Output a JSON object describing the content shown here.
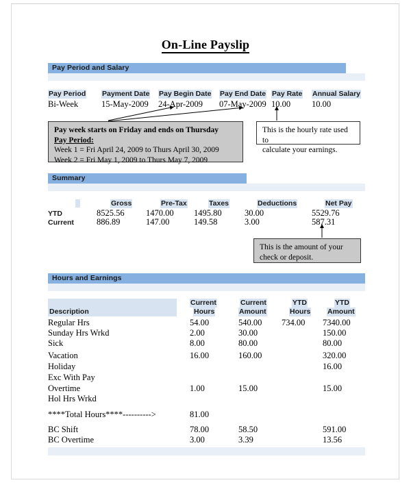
{
  "document": {
    "title": "On-Line Payslip"
  },
  "sections": {
    "pay_period": {
      "heading": "Pay Period and Salary"
    },
    "summary": {
      "heading": "Summary"
    },
    "hours_earnings": {
      "heading": "Hours and Earnings"
    }
  },
  "pay_period_table": {
    "headers": [
      "Pay Period",
      "Payment Date",
      "Pay Begin Date",
      "Pay End Date",
      "Pay Rate",
      "Annual Salary"
    ],
    "values": [
      "Bi-Week",
      "15-May-2009",
      "24-Apr-2009",
      "07-May-2009",
      "10.00",
      "10.00"
    ]
  },
  "callouts": {
    "pay_week": {
      "line1": "Pay week starts on Friday and ends on Thursday",
      "line2": "Pay Period:",
      "line3": "Week 1 = Fri April 24, 2009 to Thurs April 30, 2009",
      "line4": "Week 2 = Fri May 1, 2009 to Thurs May 7, 2009"
    },
    "hourly_rate": {
      "line1": "This is the hourly rate used to",
      "line2": "calculate your earnings."
    },
    "net_pay": {
      "line1": "This is the amount of your",
      "line2": "check or deposit."
    }
  },
  "summary_table": {
    "headers": [
      "",
      "Gross",
      "Pre-Tax",
      "Taxes",
      "Deductions",
      "Net Pay"
    ],
    "rows": [
      {
        "label": "YTD",
        "gross": "8525.56",
        "pre_tax": "1470.00",
        "taxes": "1495.80",
        "deductions": "30.00",
        "net_pay": "5529.76"
      },
      {
        "label": "Current",
        "gross": "886.89",
        "pre_tax": "147.00",
        "taxes": "149.58",
        "deductions": "3.00",
        "net_pay": "587.31"
      }
    ]
  },
  "earnings_table": {
    "headers": {
      "description": "Description",
      "current_hours_l1": "Current",
      "current_hours_l2": "Hours",
      "current_amount_l1": "Current",
      "current_amount_l2": "Amount",
      "ytd_hours_l1": "YTD",
      "ytd_hours_l2": "Hours",
      "ytd_amount_l1": "YTD",
      "ytd_amount_l2": "Amount"
    },
    "rows": [
      {
        "description": "Regular Hrs",
        "current_hours": "54.00",
        "current_amount": "540.00",
        "ytd_hours": "734.00",
        "ytd_amount": "7340.00"
      },
      {
        "description": "Sunday Hrs Wrkd",
        "current_hours": "2.00",
        "current_amount": "30.00",
        "ytd_hours": "",
        "ytd_amount": "150.00"
      },
      {
        "description": "Sick",
        "current_hours": "8.00",
        "current_amount": "80.00",
        "ytd_hours": "",
        "ytd_amount": "80.00"
      },
      {
        "description": "Vacation",
        "current_hours": "16.00",
        "current_amount": "160.00",
        "ytd_hours": "",
        "ytd_amount": "320.00"
      },
      {
        "description": "Holiday",
        "current_hours": "",
        "current_amount": "",
        "ytd_hours": "",
        "ytd_amount": "16.00"
      },
      {
        "description": "Exc With Pay",
        "current_hours": "",
        "current_amount": "",
        "ytd_hours": "",
        "ytd_amount": ""
      },
      {
        "description": "Overtime",
        "current_hours": "1.00",
        "current_amount": "15.00",
        "ytd_hours": "",
        "ytd_amount": "15.00"
      },
      {
        "description": "Hol Hrs Wrkd",
        "current_hours": "",
        "current_amount": "",
        "ytd_hours": "",
        "ytd_amount": ""
      }
    ],
    "total_row": {
      "description": "****Total Hours****---------->",
      "current_hours": "81.00"
    },
    "bc_rows": [
      {
        "description": "BC Shift",
        "current_hours": "78.00",
        "current_amount": "58.50",
        "ytd_hours": "",
        "ytd_amount": "591.00"
      },
      {
        "description": "BC Overtime",
        "current_hours": "3.00",
        "current_amount": "3.39",
        "ytd_hours": "",
        "ytd_amount": "13.56"
      }
    ]
  },
  "colors": {
    "band_blue": "#85b0e0",
    "subband_blue": "#e9eff6",
    "header_highlight": "#d7e3f1",
    "callout_gray": "#c9c9c9",
    "text": "#000000"
  }
}
